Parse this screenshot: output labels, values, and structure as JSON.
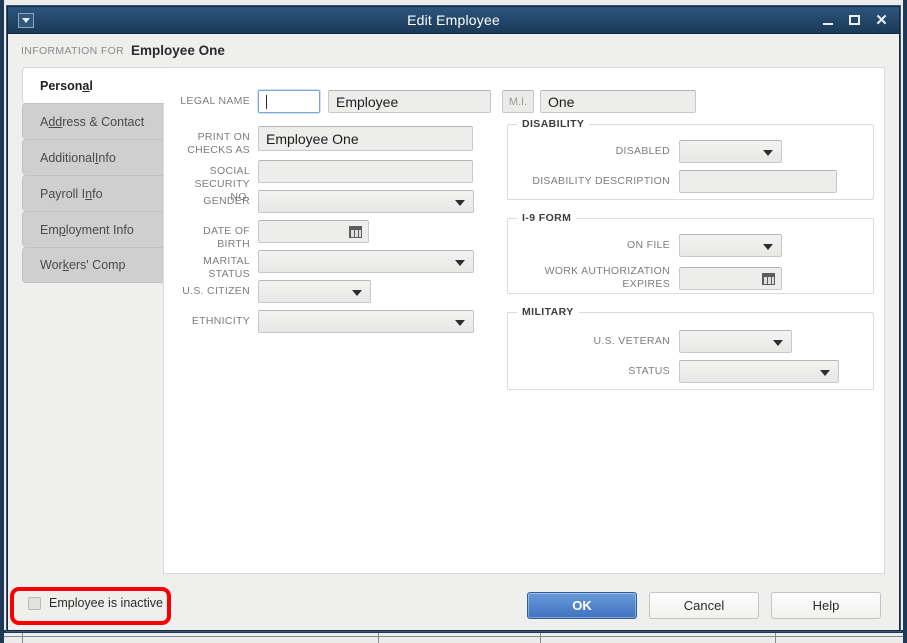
{
  "window": {
    "title": "Edit Employee",
    "sysmenu_icon": "window-menu-icon",
    "minimize_label": "minimize-icon",
    "maximize_label": "maximize-icon",
    "close_label": "close-icon"
  },
  "header": {
    "information_for_label": "INFORMATION FOR",
    "employee_name": "Employee One"
  },
  "tabs": [
    {
      "label": "Person",
      "accel": "a",
      "tail": "l",
      "active": true
    },
    {
      "label": "A",
      "accel": "dd",
      "tail": "ress & Contact",
      "active": false
    },
    {
      "label": "Additional ",
      "accel": "I",
      "tail": "nfo",
      "active": false
    },
    {
      "label": "Payroll I",
      "accel": "n",
      "tail": "fo",
      "active": false
    },
    {
      "label": "Em",
      "accel": "p",
      "tail": "loyment Info",
      "active": false
    },
    {
      "label": "Wor",
      "accel": "k",
      "tail": "ers' Comp",
      "active": false
    }
  ],
  "form": {
    "legal_name_label": "LEGAL NAME",
    "first_name_value": "",
    "first_name_focused": true,
    "middle_name_value": "Employee",
    "mi_label": "M.I.",
    "mi_value": "",
    "last_name_value": "One",
    "print_on_checks_label": "PRINT ON CHECKS AS",
    "print_on_checks_value": "Employee One",
    "ssn_label": "SOCIAL SECURITY NO.",
    "ssn_value": "",
    "gender_label": "GENDER",
    "gender_value": "",
    "dob_label": "DATE OF BIRTH",
    "dob_value": "",
    "marital_status_label": "MARITAL STATUS",
    "marital_status_value": "",
    "us_citizen_label": "U.S. CITIZEN",
    "us_citizen_value": "",
    "ethnicity_label": "ETHNICITY",
    "ethnicity_value": ""
  },
  "disability": {
    "legend": "DISABILITY",
    "disabled_label": "DISABLED",
    "disabled_value": "",
    "description_label": "DISABILITY DESCRIPTION",
    "description_value": ""
  },
  "i9": {
    "legend": "I-9 FORM",
    "on_file_label": "ON FILE",
    "on_file_value": "",
    "work_auth_label": "WORK AUTHORIZATION EXPIRES",
    "work_auth_value": ""
  },
  "military": {
    "legend": "MILITARY",
    "veteran_label": "U.S. VETERAN",
    "veteran_value": "",
    "status_label": "STATUS",
    "status_value": ""
  },
  "footer": {
    "inactive_checkbox_label": "Employee is inactive",
    "inactive_checked": false,
    "ok_label": "OK",
    "cancel_label": "Cancel",
    "help_label": "Help"
  },
  "colors": {
    "titlebar": "#24486b",
    "primary_button": "#3f72bf",
    "annotation": "#fb0000",
    "panel": "#ffffff",
    "chrome": "#efefed"
  }
}
